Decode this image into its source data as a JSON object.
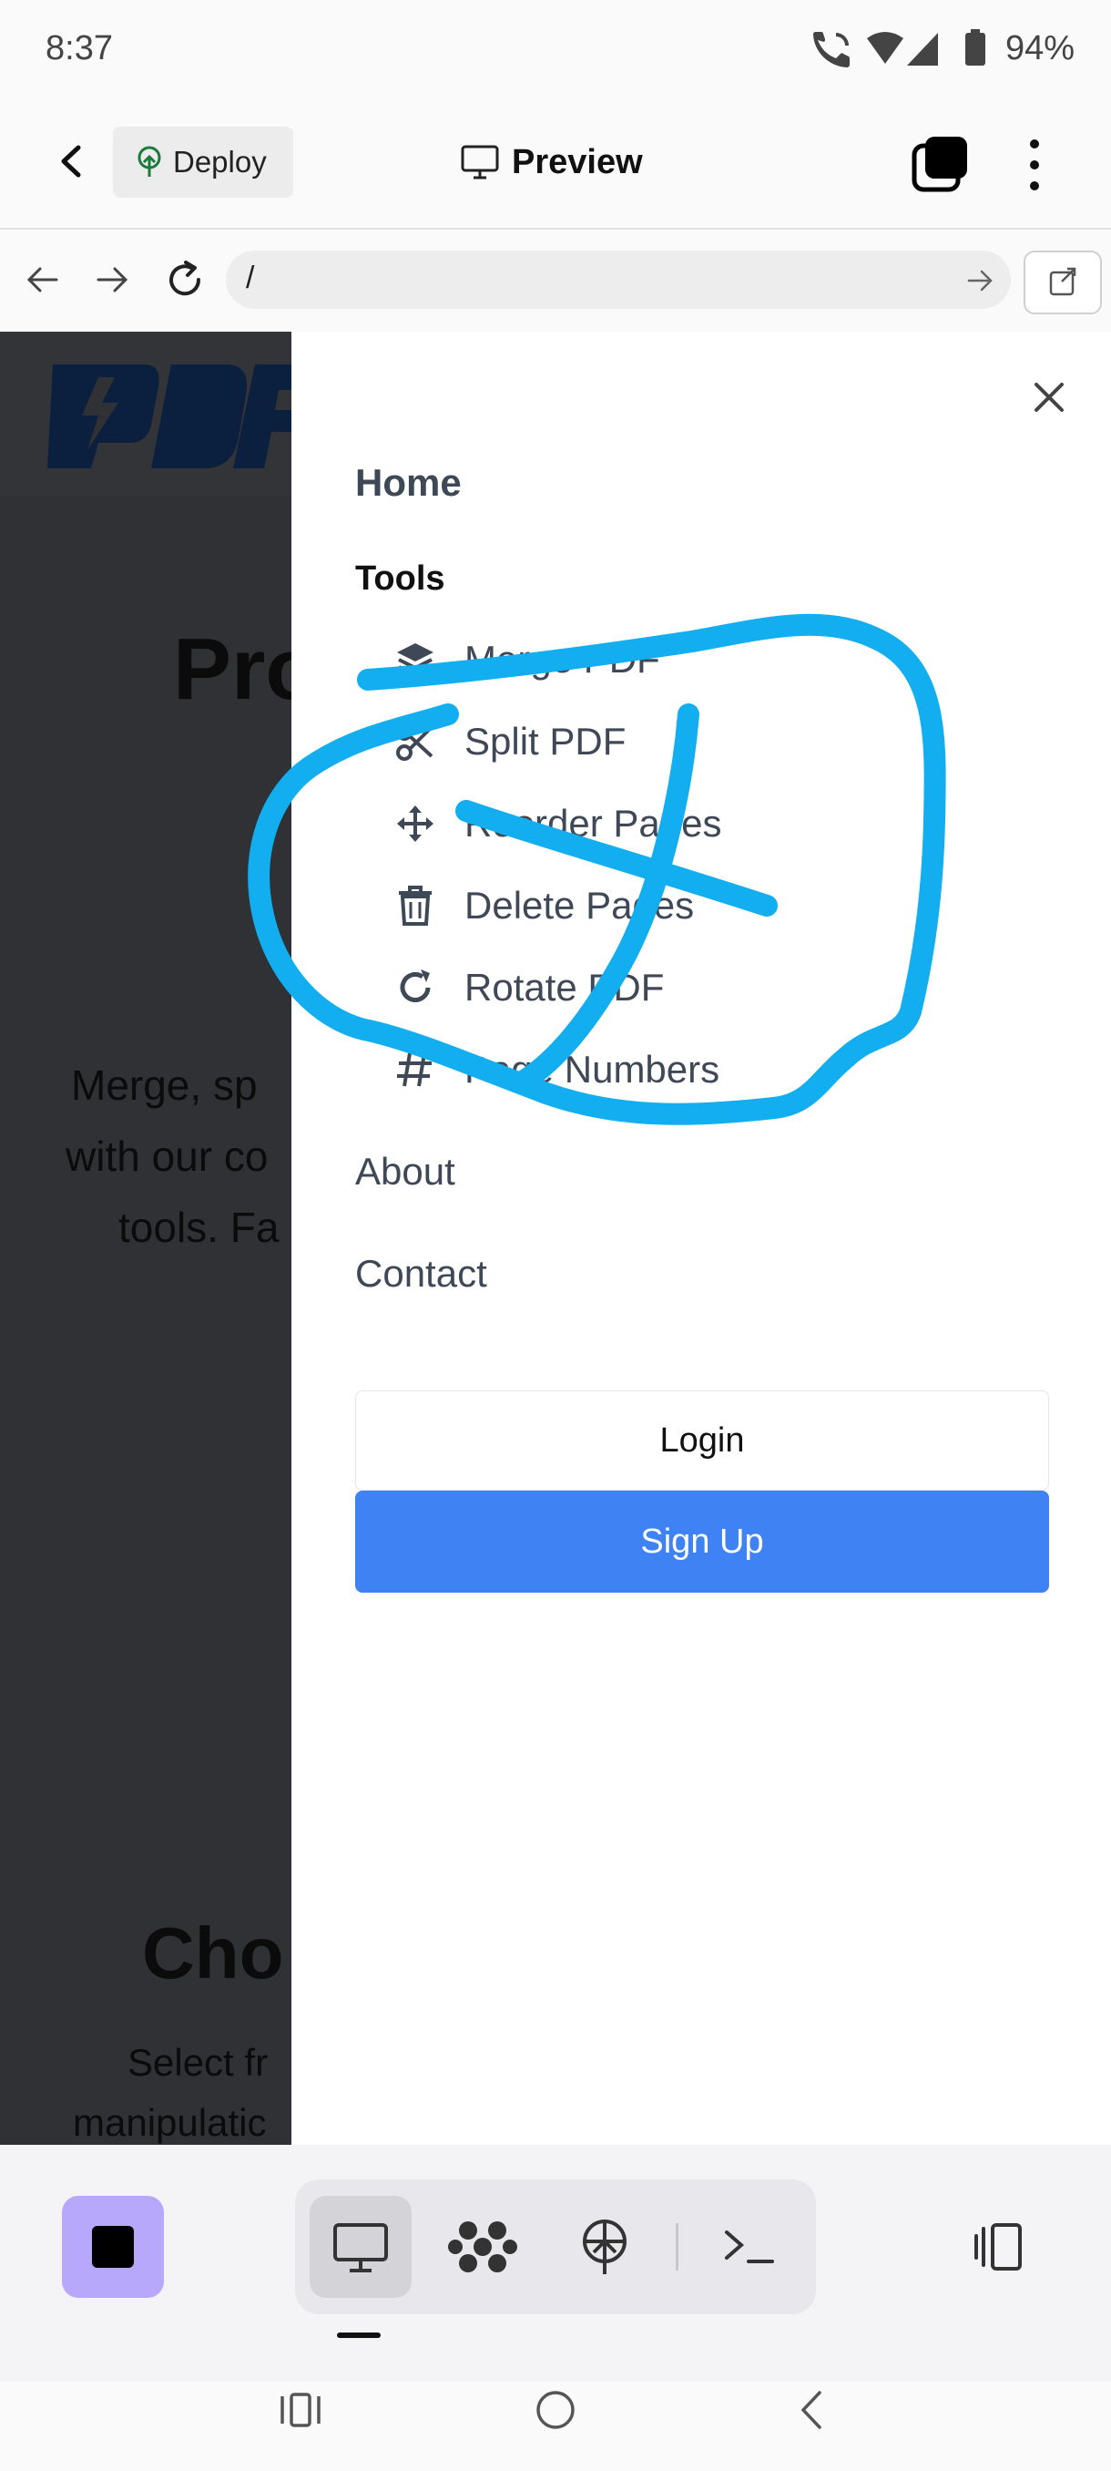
{
  "status_bar": {
    "time": "8:37",
    "battery": "94%",
    "icons": [
      "call-wifi-icon",
      "wifi-icon",
      "signal-icon",
      "battery-icon"
    ]
  },
  "header": {
    "back_icon": "chevron-left-icon",
    "deploy_label": "Deploy",
    "deploy_icon": "tree-upload-icon",
    "preview_label": "Preview",
    "preview_icon": "monitor-icon",
    "tabs_icon": "tabs-icon",
    "more_icon": "more-vertical-icon"
  },
  "url_bar": {
    "url": "/",
    "back_icon": "arrow-left-icon",
    "forward_icon": "arrow-right-icon",
    "reload_icon": "reload-icon",
    "go_icon": "arrow-right-icon",
    "external_icon": "external-link-icon"
  },
  "background_page": {
    "logo_text": "PDF",
    "heading_fragment": "Pro",
    "body_lines": [
      "Merge, sp",
      "with our co",
      "tools. Fa"
    ],
    "section_heading_fragment": "Cho",
    "section_lines": [
      "Select fr",
      "manipulatic"
    ]
  },
  "drawer": {
    "close_icon": "close-icon",
    "home": "Home",
    "tools_heading": "Tools",
    "tools": [
      {
        "label": "Merge PDF",
        "icon": "layers-icon"
      },
      {
        "label": "Split PDF",
        "icon": "scissors-icon"
      },
      {
        "label": "Reorder Pages",
        "icon": "move-arrows-icon"
      },
      {
        "label": "Delete Pages",
        "icon": "trash-icon"
      },
      {
        "label": "Rotate PDF",
        "icon": "rotate-icon"
      },
      {
        "label": "Page Numbers",
        "icon": "hash-icon"
      }
    ],
    "about": "About",
    "contact": "Contact",
    "login": "Login",
    "signup": "Sign Up"
  },
  "annotation": {
    "color": "#12aef0",
    "shape": "circle-with-cross"
  },
  "bottom_toolbar": {
    "stop_icon": "stop-icon",
    "modes": [
      "monitor-icon",
      "network-icon",
      "deploy-icon",
      "terminal-icon"
    ],
    "active_mode": "monitor-icon",
    "split_view_icon": "split-view-icon"
  },
  "nav_bar": {
    "icons": [
      "recent-apps-icon",
      "home-icon",
      "back-icon"
    ]
  },
  "colors": {
    "accent": "#3e82f4",
    "stop_bg": "#b8a8fb",
    "drawer_text": "#3f4857",
    "overlay_bg": "#303134"
  }
}
